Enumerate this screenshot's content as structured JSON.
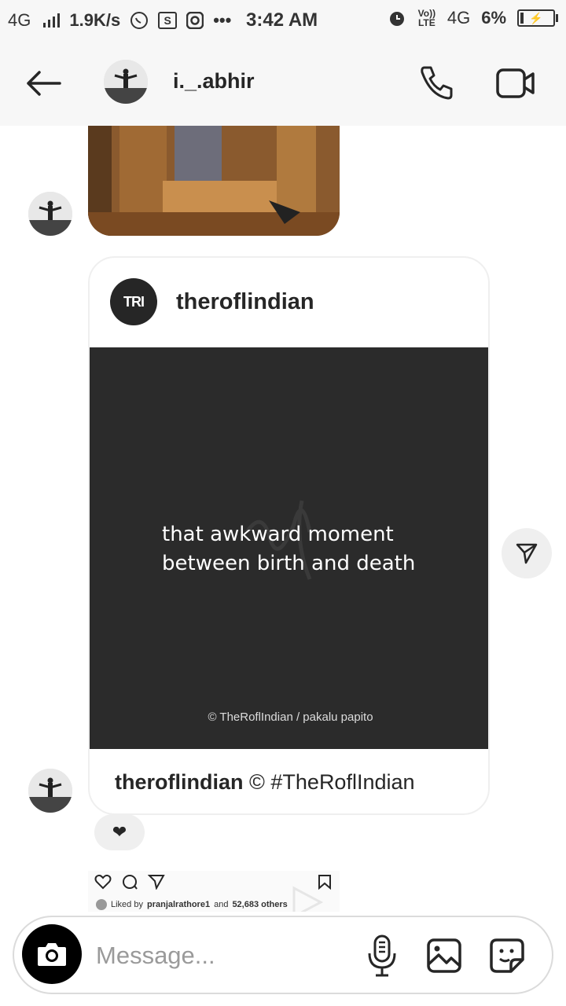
{
  "status_bar": {
    "network": "4G",
    "speed": "1.9K/s",
    "time": "3:42 AM",
    "volte": "Vo)) LTE",
    "network2": "4G",
    "battery": "6%",
    "icons": [
      "signal-icon",
      "whatsapp-icon",
      "s-app-icon",
      "instagram-icon",
      "more-dots-icon",
      "alarm-icon",
      "volte-icon",
      "battery-icon"
    ]
  },
  "header": {
    "username": "i._.abhir",
    "icons": [
      "back-arrow-icon",
      "avatar",
      "phone-icon",
      "video-icon"
    ]
  },
  "post": {
    "logo_text": "TRI",
    "author": "theroflindian",
    "image_line1": "that awkward moment",
    "image_line2": "between birth and death",
    "credit": "© TheRoflIndian / pakalu papito",
    "caption_author": "theroflindian",
    "caption_text": " © #TheRoflIndian"
  },
  "reaction": {
    "emoji": "❤"
  },
  "preview": {
    "liked_by_prefix": "Liked by",
    "liked_by_user": "pranjalrathore1",
    "liked_by_suffix": "and",
    "liked_by_others": "52,683 others"
  },
  "composer": {
    "placeholder": "Message..."
  },
  "colors": {
    "header_bg": "#f7f7f7",
    "post_bg": "#2b2b2b",
    "bubble_bg": "#efefef",
    "text": "#262626"
  }
}
